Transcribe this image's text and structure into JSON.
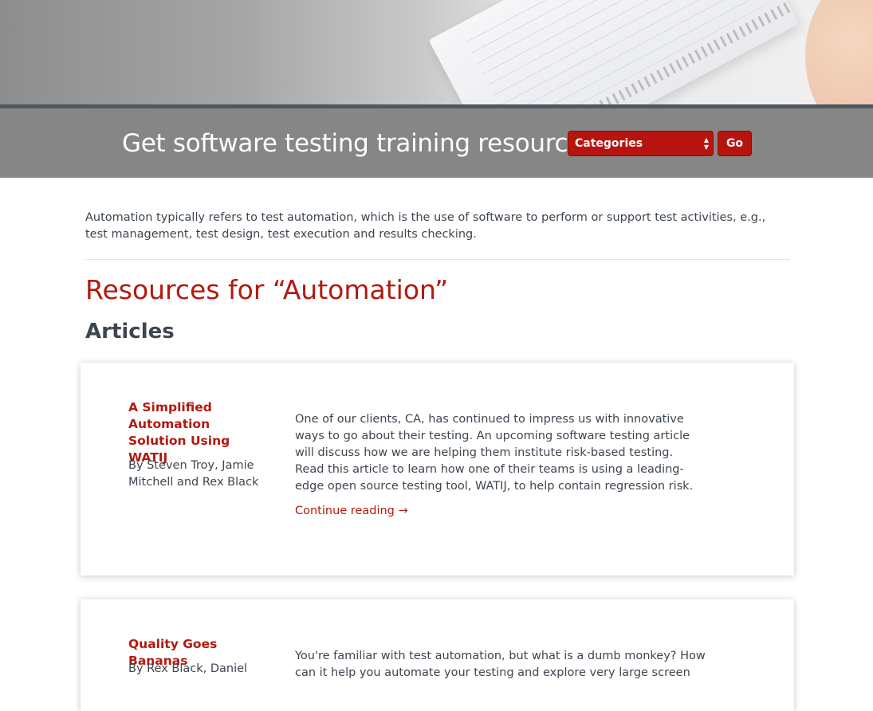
{
  "search_bar": {
    "title": "Get software testing training resources:",
    "select_value": "Categories",
    "go_label": "Go"
  },
  "intro": "Automation typically refers to test automation, which is the use of software to perform or support test activities, e.g., test management, test design, test execution and results checking.",
  "resources_title": "Resources for “Automation”",
  "articles_heading": "Articles",
  "articles": [
    {
      "title": "A Simplified Automation Solution Using WATIJ",
      "byline": "By Steven Troy, Jamie Mitchell and Rex Black",
      "excerpt": "One of our clients, CA, has continued to impress us with innovative ways to go about their testing. An upcoming software testing article will discuss how we are helping them institute risk-based testing. Read this article to learn how one of their teams is using a leading-edge open source testing tool, WATIJ, to help contain regression risk.",
      "link": "Continue reading →"
    },
    {
      "title": "Quality Goes Bananas",
      "byline": "By Rex Black, Daniel",
      "excerpt": "You're familiar with test automation, but what is a dumb monkey? How can it help you automate your testing and explore very large screen"
    }
  ]
}
